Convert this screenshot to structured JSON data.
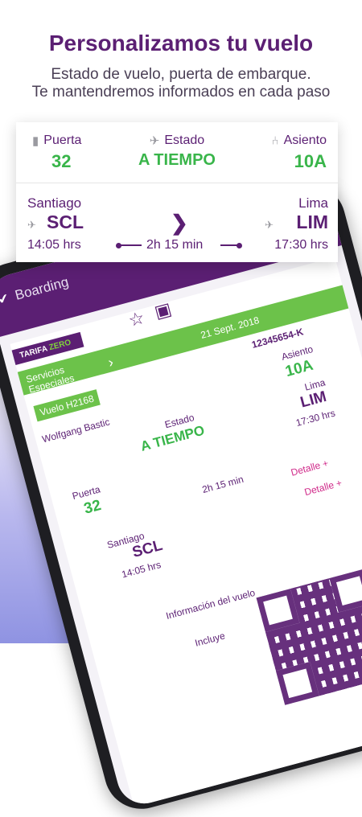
{
  "hero": {
    "title": "Personalizamos tu vuelo",
    "subtitle_line1": "Estado de vuelo, puerta de embarque.",
    "subtitle_line2": "Te mantendremos informados en cada paso"
  },
  "card": {
    "gate_label": "Puerta",
    "gate_value": "32",
    "status_label": "Estado",
    "status_value": "A TIEMPO",
    "seat_label": "Asiento",
    "seat_value": "10A",
    "origin_city": "Santiago",
    "origin_code": "SCL",
    "origin_time": "14:05 hrs",
    "dest_city": "Lima",
    "dest_code": "LIM",
    "dest_time": "17:30 hrs",
    "duration": "2h 15 min"
  },
  "phone": {
    "appbar_title": "Boarding",
    "tarifa_label": "TARIFA",
    "tarifa_type": "ZERO",
    "services": "Servicios Especiales",
    "date": "21 Sept. 2018",
    "booking": "12345654-K",
    "flight": "Vuelo H2168",
    "passenger": "Wolfgang Bastic",
    "seat_label": "Asiento",
    "seat_value": "10A",
    "status_label": "Estado",
    "status_value": "A TIEMPO",
    "dest_city": "Lima",
    "dest_code": "LIM",
    "dest_time": "17:30 hrs",
    "gate_label": "Puerta",
    "gate_value": "32",
    "duration": "2h 15 min",
    "origin_city": "Santiago",
    "origin_code": "SCL",
    "origin_time": "14:05 hrs",
    "detail_1": "Detalle +",
    "detail_2": "Detalle +",
    "info_label": "Información del vuelo",
    "includes_label": "Incluye"
  },
  "colors": {
    "brand_purple": "#5b1f73",
    "status_green": "#39b54a",
    "accent_pink": "#d02a8a"
  }
}
